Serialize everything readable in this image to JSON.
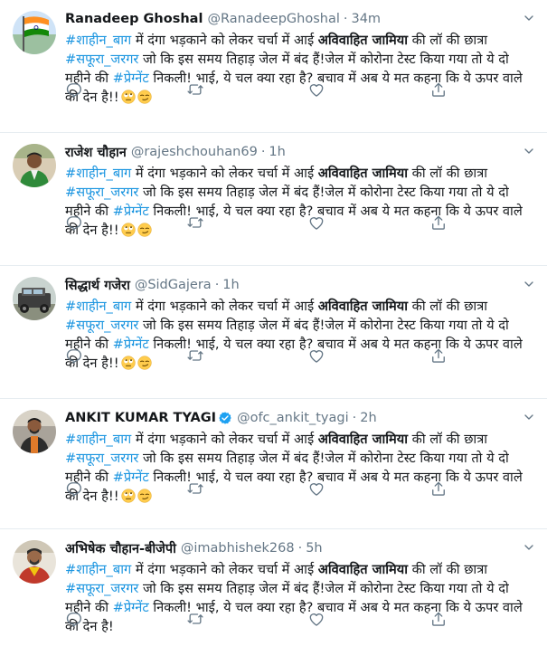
{
  "tweets": [
    {
      "name": "Ranadeep Ghoshal",
      "handle": "@RanadeepGhoshal",
      "separator": "·",
      "time": "34m",
      "verified": false,
      "avatar": "flag-avatar",
      "body": {
        "tag1": "#शाहीन_बाग",
        "t1": " में दंगा भड़काने को लेकर चर्चा में आई ",
        "b1": "अविवाहित जामिया",
        "t2": " की लॉ की छात्रा ",
        "tag2": "#सफूरा_जरगर",
        "t3": " जो कि इस समय तिहाड़ जेल में बंद हैं!जेल में कोरोना टेस्ट किया गया तो ये दो महीने की ",
        "tag3": "#प्रेग्नेंट",
        "t4": " निकली! भाई, ये चल क्या रहा है? बचाव में अब ये मत कहना कि ये ऊपर वाले की देन है!!"
      },
      "emojis": [
        "rolling-eyes-emoji",
        "smirk-emoji"
      ]
    },
    {
      "name": "राजेश चौहान",
      "handle": "@rajeshchouhan69",
      "separator": "·",
      "time": "1h",
      "verified": false,
      "avatar": "person-green-avatar",
      "body": {
        "tag1": "#शाहीन_बाग",
        "t1": " में दंगा भड़काने को लेकर चर्चा में आई ",
        "b1": "अविवाहित जामिया",
        "t2": " की लॉ की छात्रा ",
        "tag2": "#सफूरा_जरगर",
        "t3": " जो कि इस समय तिहाड़ जेल में बंद हैं!जेल में कोरोना टेस्ट किया गया तो ये दो महीने की ",
        "tag3": "#प्रेग्नेंट",
        "t4": " निकली! भाई, ये चल क्या रहा है? बचाव में अब ये मत कहना कि ये ऊपर वाले की देन है!!"
      },
      "emojis": [
        "rolling-eyes-emoji",
        "smirk-emoji"
      ]
    },
    {
      "name": "सिद्धार्थ गजेरा",
      "handle": "@SidGajera",
      "separator": "·",
      "time": "1h",
      "verified": false,
      "avatar": "jeep-avatar",
      "body": {
        "tag1": "#शाहीन_बाग",
        "t1": " में दंगा भड़काने को लेकर चर्चा में आई ",
        "b1": "अविवाहित जामिया",
        "t2": " की लॉ की छात्रा ",
        "tag2": "#सफूरा_जरगर",
        "t3": " जो कि इस समय तिहाड़ जेल में बंद हैं!जेल में कोरोना टेस्ट किया गया तो ये दो महीने की ",
        "tag3": "#प्रेग्नेंट",
        "t4": " निकली! भाई, ये चल क्या रहा है? बचाव में अब ये मत कहना कि ये ऊपर वाले की देन है!!"
      },
      "emojis": [
        "rolling-eyes-emoji",
        "smirk-emoji"
      ]
    },
    {
      "name": "ANKIT KUMAR TYAGI",
      "handle": "@ofc_ankit_tyagi",
      "separator": "·",
      "time": "2h",
      "verified": true,
      "avatar": "person-orange-avatar",
      "body": {
        "tag1": "#शाहीन_बाग",
        "t1": " में दंगा भड़काने को लेकर चर्चा में आई ",
        "b1": "अविवाहित जामिया",
        "t2": " की लॉ की छात्रा ",
        "tag2": "#सफूरा_जरगर",
        "t3": " जो कि इस समय तिहाड़ जेल में बंद हैं!जेल में कोरोना टेस्ट किया गया तो ये दो महीने की ",
        "tag3": "#प्रेग्नेंट",
        "t4": " निकली! भाई, ये चल क्या रहा है? बचाव में अब ये मत कहना कि ये ऊपर वाले की देन है!!"
      },
      "emojis": [
        "rolling-eyes-emoji",
        "smirk-emoji"
      ]
    },
    {
      "name": "अभिषेक चौहान-बीजेपी",
      "handle": "@imabhishek268",
      "separator": "·",
      "time": "5h",
      "verified": false,
      "avatar": "person-red-avatar",
      "body": {
        "tag1": "#शाहीन_बाग",
        "t1": " में दंगा भड़काने को लेकर चर्चा में आई ",
        "b1": "अविवाहित जामिया",
        "t2": " की लॉ की छात्रा ",
        "tag2": "#सफूरा_जरगर",
        "t3": " जो कि इस समय तिहाड़ जेल में बंद हैं!जेल में कोरोना टेस्ट किया गया तो ये दो महीने की ",
        "tag3": "#प्रेग्नेंट",
        "t4": " निकली! भाई, ये चल क्या रहा है? बचाव में अब ये मत कहना कि ये ऊपर वाले की देन है!"
      },
      "emojis": []
    }
  ],
  "icons": {
    "reply": "reply-icon",
    "retweet": "retweet-icon",
    "like": "like-icon",
    "share": "share-icon",
    "menu": "chevron-down-icon",
    "verified": "verified-badge-icon"
  },
  "colors": {
    "link": "#1b95e0",
    "text": "#14171a",
    "muted": "#657786",
    "divider": "#e6ecf0",
    "verified": "#1da1f2"
  }
}
